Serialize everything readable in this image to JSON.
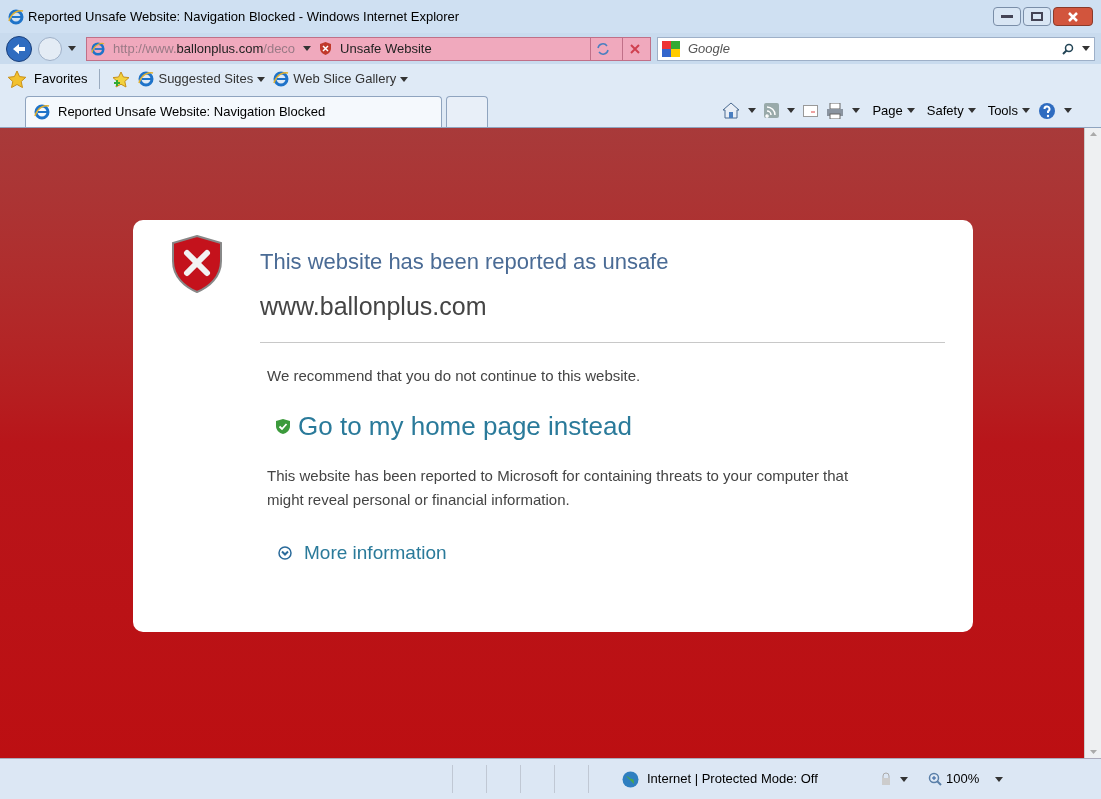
{
  "window": {
    "title": "Reported Unsafe Website: Navigation Blocked - Windows Internet Explorer"
  },
  "address_bar": {
    "url_prefix": "http://www.",
    "url_host": "ballonplus.com",
    "url_suffix": "/deco",
    "status": "Unsafe Website"
  },
  "search": {
    "placeholder": "Google"
  },
  "favorites_bar": {
    "favorites": "Favorites",
    "links": [
      "Suggested Sites",
      "Web Slice Gallery"
    ]
  },
  "tabs": [
    {
      "label": "Reported Unsafe Website: Navigation Blocked",
      "selected": true
    }
  ],
  "command_bar": {
    "menus": [
      "Page",
      "Safety",
      "Tools"
    ]
  },
  "warning": {
    "title": "This website has been reported as unsafe",
    "site": "www.ballonplus.com",
    "recommendation": "We recommend that you do not continue to this website.",
    "home_link": "Go to my home page instead",
    "explanation": "This website has been reported to Microsoft for containing threats to your computer that might reveal personal or financial information.",
    "more_info": "More information",
    "expanded": false
  },
  "status_bar": {
    "zone": "Internet | Protected Mode: Off",
    "zoom": "100%"
  }
}
